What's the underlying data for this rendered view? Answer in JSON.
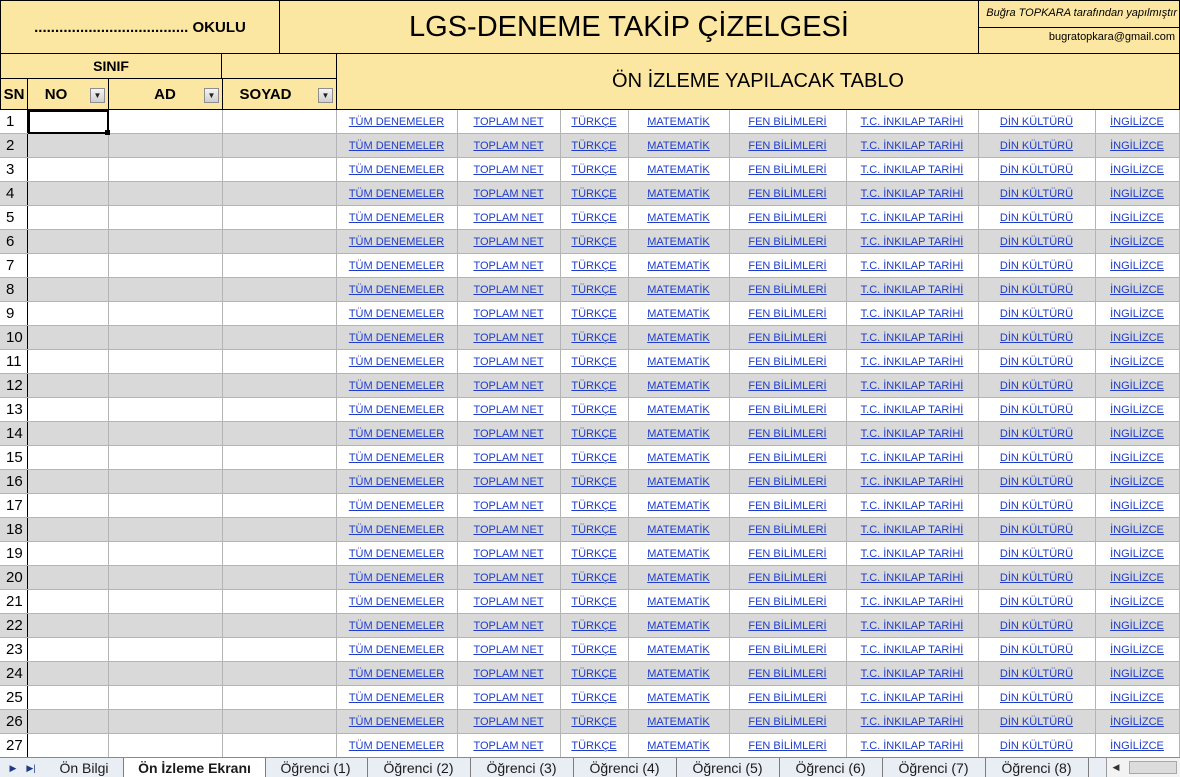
{
  "header": {
    "school": "..................................... OKULU",
    "title": "LGS-DENEME TAKİP ÇİZELGESİ",
    "author": "Buğra TOPKARA tarafından yapılmıştır",
    "email": "bugratopkara@gmail.com",
    "sinif": "SINIF",
    "preview": "ÖN İZLEME YAPILACAK TABLO"
  },
  "columns": {
    "sn": "SN",
    "no": "NO",
    "ad": "AD",
    "soyad": "SOYAD"
  },
  "links": [
    "TÜM DENEMELER",
    "TOPLAM NET",
    "TÜRKÇE",
    "MATEMATİK",
    "FEN BİLİMLERİ",
    "T.C. İNKILAP TARİHİ",
    "DİN KÜLTÜRÜ",
    "İNGİLİZCE"
  ],
  "rows": [
    1,
    2,
    3,
    4,
    5,
    6,
    7,
    8,
    9,
    10,
    11,
    12,
    13,
    14,
    15,
    16,
    17,
    18,
    19,
    20,
    21,
    22,
    23,
    24,
    25,
    26,
    27
  ],
  "tabs": {
    "items": [
      "Ön Bilgi",
      "Ön İzleme Ekranı",
      "Öğrenci (1)",
      "Öğrenci (2)",
      "Öğrenci (3)",
      "Öğrenci (4)",
      "Öğrenci (5)",
      "Öğrenci (6)",
      "Öğrenci (7)",
      "Öğrenci (8)"
    ],
    "active": 1
  },
  "icons": {
    "dropdown": "dropdown-arrow-icon",
    "tab_nav_next": "tab-scroll-next-icon",
    "tab_nav_last": "tab-scroll-last-icon",
    "scroll_left": "scroll-left-icon"
  }
}
